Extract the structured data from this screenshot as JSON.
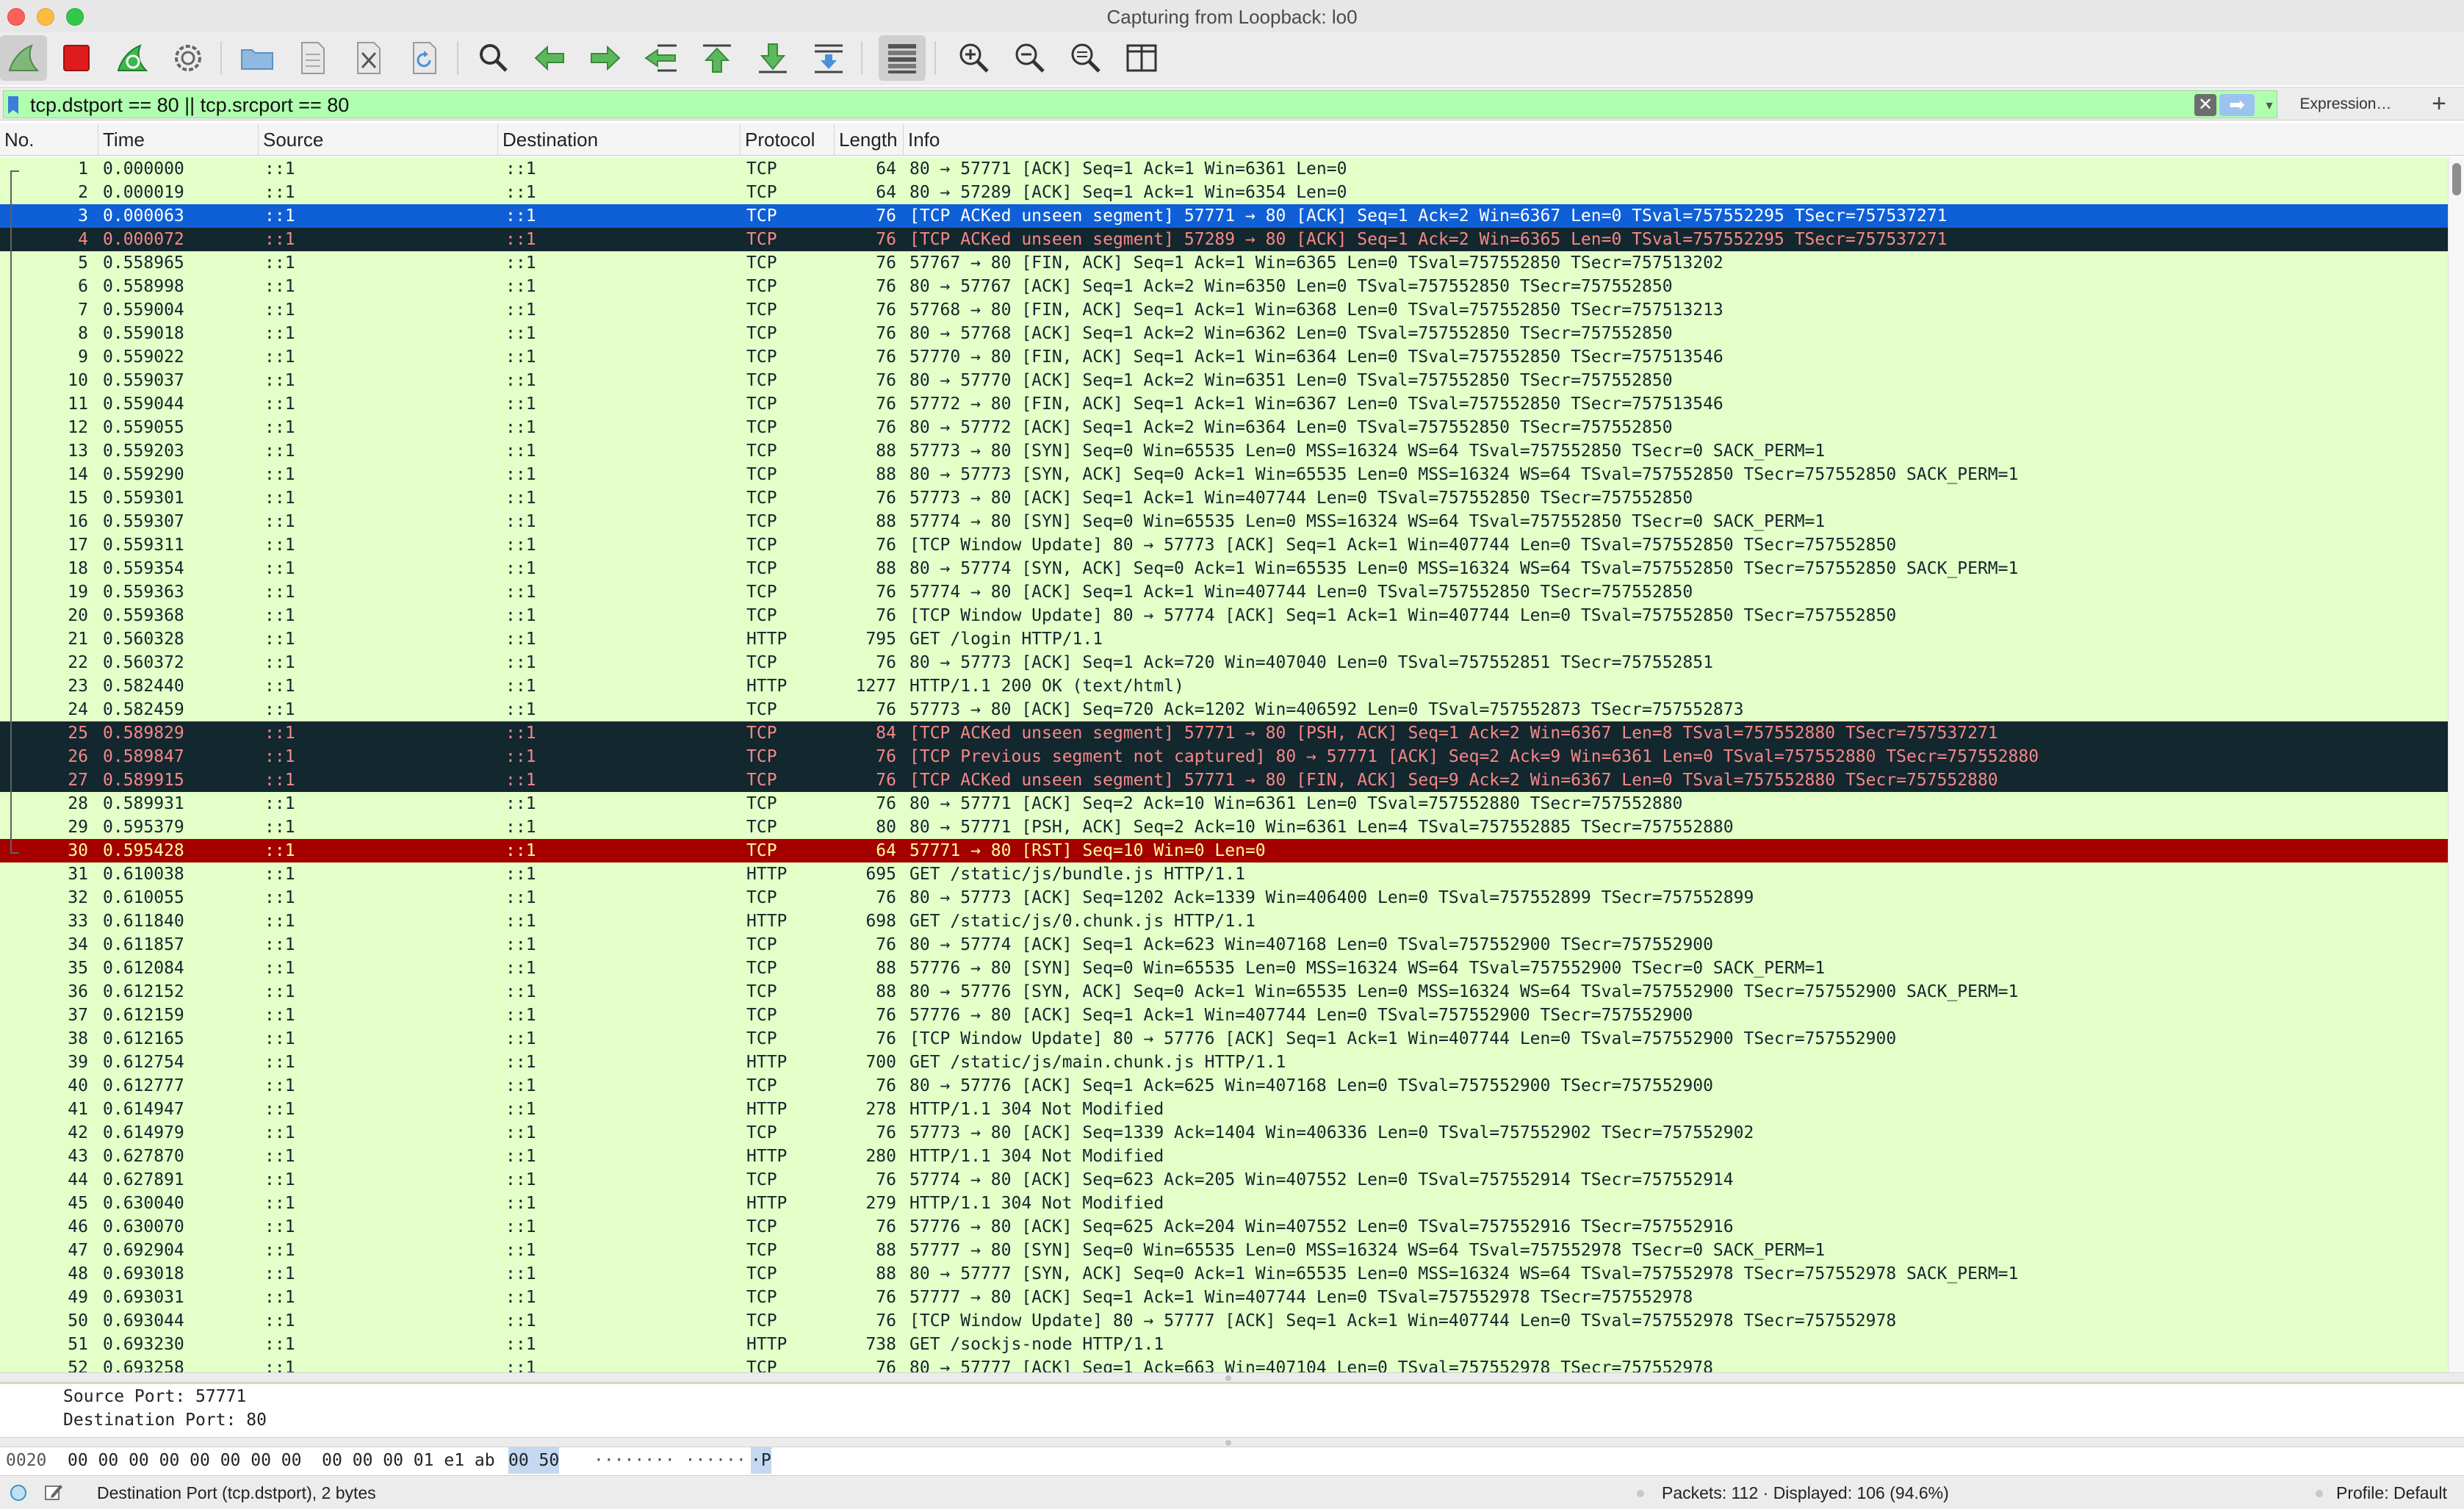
{
  "window": {
    "title": "Capturing from Loopback: lo0"
  },
  "toolbar": {
    "buttons": [
      {
        "name": "start-capture",
        "icon": "shark-fin-icon"
      },
      {
        "name": "stop-capture",
        "icon": "stop-icon"
      },
      {
        "name": "restart-capture",
        "icon": "restart-fin-icon"
      },
      {
        "name": "capture-options",
        "icon": "gear-icon"
      },
      {
        "name": "open-file",
        "icon": "folder-icon"
      },
      {
        "name": "save-file",
        "icon": "file-icon"
      },
      {
        "name": "close-file",
        "icon": "close-file-icon"
      },
      {
        "name": "reload-file",
        "icon": "reload-icon"
      },
      {
        "name": "find-packet",
        "icon": "search-icon"
      },
      {
        "name": "go-back",
        "icon": "arrow-left-icon"
      },
      {
        "name": "go-forward",
        "icon": "arrow-right-icon"
      },
      {
        "name": "go-to-packet",
        "icon": "goto-packet-icon"
      },
      {
        "name": "first-packet",
        "icon": "first-packet-icon"
      },
      {
        "name": "last-packet",
        "icon": "last-packet-icon"
      },
      {
        "name": "auto-scroll",
        "icon": "autoscroll-icon"
      },
      {
        "name": "colorize",
        "icon": "colorize-icon"
      },
      {
        "name": "zoom-in",
        "icon": "zoom-in-icon"
      },
      {
        "name": "zoom-out",
        "icon": "zoom-out-icon"
      },
      {
        "name": "normal-size",
        "icon": "zoom-reset-icon"
      },
      {
        "name": "resize-columns",
        "icon": "resize-columns-icon"
      }
    ]
  },
  "filter": {
    "value": "tcp.dstport == 80 || tcp.srcport == 80",
    "clear_icon": "✕",
    "apply_icon": "➡",
    "dropdown_icon": "▾",
    "expression_label": "Expression…",
    "add_label": "+"
  },
  "columns": [
    "No.",
    "Time",
    "Source",
    "Destination",
    "Protocol",
    "Length",
    "Info"
  ],
  "colors": {
    "row_default": "#e4ffc7",
    "row_selected": "#0f5fd7",
    "row_bad_tcp": "#12272e",
    "row_rst": "#a40000"
  },
  "packets": [
    [
      "1",
      "0.000000",
      "::1",
      "::1",
      "TCP",
      "64",
      "80 → 57771 [ACK] Seq=1 Ack=1 Win=6361 Len=0"
    ],
    [
      "2",
      "0.000019",
      "::1",
      "::1",
      "TCP",
      "64",
      "80 → 57289 [ACK] Seq=1 Ack=1 Win=6354 Len=0"
    ],
    [
      "3",
      "0.000063",
      "::1",
      "::1",
      "TCP",
      "76",
      "[TCP ACKed unseen segment] 57771 → 80 [ACK] Seq=1 Ack=2 Win=6367 Len=0 TSval=757552295 TSecr=757537271"
    ],
    [
      "4",
      "0.000072",
      "::1",
      "::1",
      "TCP",
      "76",
      "[TCP ACKed unseen segment] 57289 → 80 [ACK] Seq=1 Ack=2 Win=6365 Len=0 TSval=757552295 TSecr=757537271"
    ],
    [
      "5",
      "0.558965",
      "::1",
      "::1",
      "TCP",
      "76",
      "57767 → 80 [FIN, ACK] Seq=1 Ack=1 Win=6365 Len=0 TSval=757552850 TSecr=757513202"
    ],
    [
      "6",
      "0.558998",
      "::1",
      "::1",
      "TCP",
      "76",
      "80 → 57767 [ACK] Seq=1 Ack=2 Win=6350 Len=0 TSval=757552850 TSecr=757552850"
    ],
    [
      "7",
      "0.559004",
      "::1",
      "::1",
      "TCP",
      "76",
      "57768 → 80 [FIN, ACK] Seq=1 Ack=1 Win=6368 Len=0 TSval=757552850 TSecr=757513213"
    ],
    [
      "8",
      "0.559018",
      "::1",
      "::1",
      "TCP",
      "76",
      "80 → 57768 [ACK] Seq=1 Ack=2 Win=6362 Len=0 TSval=757552850 TSecr=757552850"
    ],
    [
      "9",
      "0.559022",
      "::1",
      "::1",
      "TCP",
      "76",
      "57770 → 80 [FIN, ACK] Seq=1 Ack=1 Win=6364 Len=0 TSval=757552850 TSecr=757513546"
    ],
    [
      "10",
      "0.559037",
      "::1",
      "::1",
      "TCP",
      "76",
      "80 → 57770 [ACK] Seq=1 Ack=2 Win=6351 Len=0 TSval=757552850 TSecr=757552850"
    ],
    [
      "11",
      "0.559044",
      "::1",
      "::1",
      "TCP",
      "76",
      "57772 → 80 [FIN, ACK] Seq=1 Ack=1 Win=6367 Len=0 TSval=757552850 TSecr=757513546"
    ],
    [
      "12",
      "0.559055",
      "::1",
      "::1",
      "TCP",
      "76",
      "80 → 57772 [ACK] Seq=1 Ack=2 Win=6364 Len=0 TSval=757552850 TSecr=757552850"
    ],
    [
      "13",
      "0.559203",
      "::1",
      "::1",
      "TCP",
      "88",
      "57773 → 80 [SYN] Seq=0 Win=65535 Len=0 MSS=16324 WS=64 TSval=757552850 TSecr=0 SACK_PERM=1"
    ],
    [
      "14",
      "0.559290",
      "::1",
      "::1",
      "TCP",
      "88",
      "80 → 57773 [SYN, ACK] Seq=0 Ack=1 Win=65535 Len=0 MSS=16324 WS=64 TSval=757552850 TSecr=757552850 SACK_PERM=1"
    ],
    [
      "15",
      "0.559301",
      "::1",
      "::1",
      "TCP",
      "76",
      "57773 → 80 [ACK] Seq=1 Ack=1 Win=407744 Len=0 TSval=757552850 TSecr=757552850"
    ],
    [
      "16",
      "0.559307",
      "::1",
      "::1",
      "TCP",
      "88",
      "57774 → 80 [SYN] Seq=0 Win=65535 Len=0 MSS=16324 WS=64 TSval=757552850 TSecr=0 SACK_PERM=1"
    ],
    [
      "17",
      "0.559311",
      "::1",
      "::1",
      "TCP",
      "76",
      "[TCP Window Update] 80 → 57773 [ACK] Seq=1 Ack=1 Win=407744 Len=0 TSval=757552850 TSecr=757552850"
    ],
    [
      "18",
      "0.559354",
      "::1",
      "::1",
      "TCP",
      "88",
      "80 → 57774 [SYN, ACK] Seq=0 Ack=1 Win=65535 Len=0 MSS=16324 WS=64 TSval=757552850 TSecr=757552850 SACK_PERM=1"
    ],
    [
      "19",
      "0.559363",
      "::1",
      "::1",
      "TCP",
      "76",
      "57774 → 80 [ACK] Seq=1 Ack=1 Win=407744 Len=0 TSval=757552850 TSecr=757552850"
    ],
    [
      "20",
      "0.559368",
      "::1",
      "::1",
      "TCP",
      "76",
      "[TCP Window Update] 80 → 57774 [ACK] Seq=1 Ack=1 Win=407744 Len=0 TSval=757552850 TSecr=757552850"
    ],
    [
      "21",
      "0.560328",
      "::1",
      "::1",
      "HTTP",
      "795",
      "GET /login HTTP/1.1"
    ],
    [
      "22",
      "0.560372",
      "::1",
      "::1",
      "TCP",
      "76",
      "80 → 57773 [ACK] Seq=1 Ack=720 Win=407040 Len=0 TSval=757552851 TSecr=757552851"
    ],
    [
      "23",
      "0.582440",
      "::1",
      "::1",
      "HTTP",
      "1277",
      "HTTP/1.1 200 OK  (text/html)"
    ],
    [
      "24",
      "0.582459",
      "::1",
      "::1",
      "TCP",
      "76",
      "57773 → 80 [ACK] Seq=720 Ack=1202 Win=406592 Len=0 TSval=757552873 TSecr=757552873"
    ],
    [
      "25",
      "0.589829",
      "::1",
      "::1",
      "TCP",
      "84",
      "[TCP ACKed unseen segment] 57771 → 80 [PSH, ACK] Seq=1 Ack=2 Win=6367 Len=8 TSval=757552880 TSecr=757537271"
    ],
    [
      "26",
      "0.589847",
      "::1",
      "::1",
      "TCP",
      "76",
      "[TCP Previous segment not captured] 80 → 57771 [ACK] Seq=2 Ack=9 Win=6361 Len=0 TSval=757552880 TSecr=757552880"
    ],
    [
      "27",
      "0.589915",
      "::1",
      "::1",
      "TCP",
      "76",
      "[TCP ACKed unseen segment] 57771 → 80 [FIN, ACK] Seq=9 Ack=2 Win=6367 Len=0 TSval=757552880 TSecr=757552880"
    ],
    [
      "28",
      "0.589931",
      "::1",
      "::1",
      "TCP",
      "76",
      "80 → 57771 [ACK] Seq=2 Ack=10 Win=6361 Len=0 TSval=757552880 TSecr=757552880"
    ],
    [
      "29",
      "0.595379",
      "::1",
      "::1",
      "TCP",
      "80",
      "80 → 57771 [PSH, ACK] Seq=2 Ack=10 Win=6361 Len=4 TSval=757552885 TSecr=757552880"
    ],
    [
      "30",
      "0.595428",
      "::1",
      "::1",
      "TCP",
      "64",
      "57771 → 80 [RST] Seq=10 Win=0 Len=0"
    ],
    [
      "31",
      "0.610038",
      "::1",
      "::1",
      "HTTP",
      "695",
      "GET /static/js/bundle.js HTTP/1.1"
    ],
    [
      "32",
      "0.610055",
      "::1",
      "::1",
      "TCP",
      "76",
      "80 → 57773 [ACK] Seq=1202 Ack=1339 Win=406400 Len=0 TSval=757552899 TSecr=757552899"
    ],
    [
      "33",
      "0.611840",
      "::1",
      "::1",
      "HTTP",
      "698",
      "GET /static/js/0.chunk.js HTTP/1.1"
    ],
    [
      "34",
      "0.611857",
      "::1",
      "::1",
      "TCP",
      "76",
      "80 → 57774 [ACK] Seq=1 Ack=623 Win=407168 Len=0 TSval=757552900 TSecr=757552900"
    ],
    [
      "35",
      "0.612084",
      "::1",
      "::1",
      "TCP",
      "88",
      "57776 → 80 [SYN] Seq=0 Win=65535 Len=0 MSS=16324 WS=64 TSval=757552900 TSecr=0 SACK_PERM=1"
    ],
    [
      "36",
      "0.612152",
      "::1",
      "::1",
      "TCP",
      "88",
      "80 → 57776 [SYN, ACK] Seq=0 Ack=1 Win=65535 Len=0 MSS=16324 WS=64 TSval=757552900 TSecr=757552900 SACK_PERM=1"
    ],
    [
      "37",
      "0.612159",
      "::1",
      "::1",
      "TCP",
      "76",
      "57776 → 80 [ACK] Seq=1 Ack=1 Win=407744 Len=0 TSval=757552900 TSecr=757552900"
    ],
    [
      "38",
      "0.612165",
      "::1",
      "::1",
      "TCP",
      "76",
      "[TCP Window Update] 80 → 57776 [ACK] Seq=1 Ack=1 Win=407744 Len=0 TSval=757552900 TSecr=757552900"
    ],
    [
      "39",
      "0.612754",
      "::1",
      "::1",
      "HTTP",
      "700",
      "GET /static/js/main.chunk.js HTTP/1.1"
    ],
    [
      "40",
      "0.612777",
      "::1",
      "::1",
      "TCP",
      "76",
      "80 → 57776 [ACK] Seq=1 Ack=625 Win=407168 Len=0 TSval=757552900 TSecr=757552900"
    ],
    [
      "41",
      "0.614947",
      "::1",
      "::1",
      "HTTP",
      "278",
      "HTTP/1.1 304 Not Modified"
    ],
    [
      "42",
      "0.614979",
      "::1",
      "::1",
      "TCP",
      "76",
      "57773 → 80 [ACK] Seq=1339 Ack=1404 Win=406336 Len=0 TSval=757552902 TSecr=757552902"
    ],
    [
      "43",
      "0.627870",
      "::1",
      "::1",
      "HTTP",
      "280",
      "HTTP/1.1 304 Not Modified"
    ],
    [
      "44",
      "0.627891",
      "::1",
      "::1",
      "TCP",
      "76",
      "57774 → 80 [ACK] Seq=623 Ack=205 Win=407552 Len=0 TSval=757552914 TSecr=757552914"
    ],
    [
      "45",
      "0.630040",
      "::1",
      "::1",
      "HTTP",
      "279",
      "HTTP/1.1 304 Not Modified"
    ],
    [
      "46",
      "0.630070",
      "::1",
      "::1",
      "TCP",
      "76",
      "57776 → 80 [ACK] Seq=625 Ack=204 Win=407552 Len=0 TSval=757552916 TSecr=757552916"
    ],
    [
      "47",
      "0.692904",
      "::1",
      "::1",
      "TCP",
      "88",
      "57777 → 80 [SYN] Seq=0 Win=65535 Len=0 MSS=16324 WS=64 TSval=757552978 TSecr=0 SACK_PERM=1"
    ],
    [
      "48",
      "0.693018",
      "::1",
      "::1",
      "TCP",
      "88",
      "80 → 57777 [SYN, ACK] Seq=0 Ack=1 Win=65535 Len=0 MSS=16324 WS=64 TSval=757552978 TSecr=757552978 SACK_PERM=1"
    ],
    [
      "49",
      "0.693031",
      "::1",
      "::1",
      "TCP",
      "76",
      "57777 → 80 [ACK] Seq=1 Ack=1 Win=407744 Len=0 TSval=757552978 TSecr=757552978"
    ],
    [
      "50",
      "0.693044",
      "::1",
      "::1",
      "TCP",
      "76",
      "[TCP Window Update] 80 → 57777 [ACK] Seq=1 Ack=1 Win=407744 Len=0 TSval=757552978 TSecr=757552978"
    ],
    [
      "51",
      "0.693230",
      "::1",
      "::1",
      "HTTP",
      "738",
      "GET /sockjs-node HTTP/1.1"
    ],
    [
      "52",
      "0.693258",
      "::1",
      "::1",
      "TCP",
      "76",
      "80 → 57777 [ACK] Seq=1 Ack=663 Win=407104 Len=0 TSval=757552978 TSecr=757552978"
    ]
  ],
  "row_styles": {
    "3": "sel",
    "4": "bad",
    "25": "bad",
    "26": "bad",
    "27": "bad",
    "30": "rst"
  },
  "details": {
    "lines": [
      "Source Port: 57771",
      "Destination Port: 80"
    ]
  },
  "bytes": {
    "offset": "0020",
    "hex": "00 00 00 00 00 00 00 00  00 00 00 01 e1 ab",
    "hex_highlight": "00 50",
    "ascii": "········ ······",
    "ascii_highlight": "·P"
  },
  "status": {
    "field_info": "Destination Port (tcp.dstport), 2 bytes",
    "packets": "Packets: 112 · Displayed: 106 (94.6%)",
    "profile": "Profile: Default"
  }
}
